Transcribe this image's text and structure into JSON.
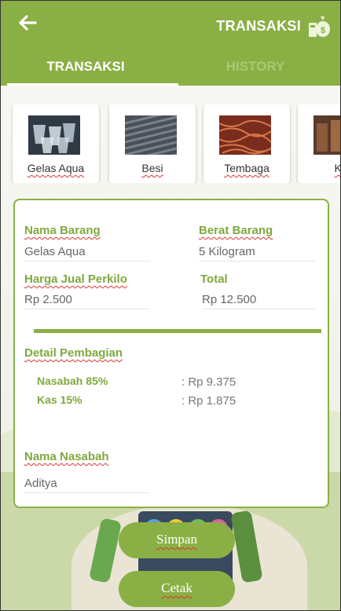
{
  "header": {
    "title": "TRANSAKSI",
    "back_icon": "arrow-left-icon",
    "money_icon": "money-bag-icon",
    "background": "#8ab045"
  },
  "tabs": [
    {
      "label": "TRANSAKSI",
      "active": true
    },
    {
      "label": "HISTORY",
      "active": false
    }
  ],
  "products": [
    {
      "label": "Gelas Aqua",
      "image": "plastic-cups"
    },
    {
      "label": "Besi",
      "image": "iron-rods"
    },
    {
      "label": "Tembaga",
      "image": "copper-wire"
    },
    {
      "label": "Ka",
      "image": "bottles"
    }
  ],
  "form": {
    "nama_barang": {
      "label": "Nama Barang",
      "value": "Gelas Aqua"
    },
    "berat_barang": {
      "label": "Berat Barang",
      "value": "5 Kilogram"
    },
    "harga": {
      "label": "Harga Jual Perkilo",
      "value": "Rp 2.500"
    },
    "total": {
      "label": "Total",
      "value": "Rp 12.500"
    },
    "detail_title": "Detail Pembagian",
    "nasabah": {
      "label": "Nasabah 85%",
      "value": ": Rp 9.375"
    },
    "kas": {
      "label": "Kas 15%",
      "value": ": Rp 1.875"
    },
    "nama_nasabah": {
      "label": "Nama Nasabah",
      "value": "Aditya"
    }
  },
  "buttons": {
    "simpan": "Simpan",
    "cetak": "Cetak"
  },
  "colors": {
    "accent": "#8ab045",
    "label_green": "#7fa93d",
    "tab_inactive": "#a9c873"
  }
}
